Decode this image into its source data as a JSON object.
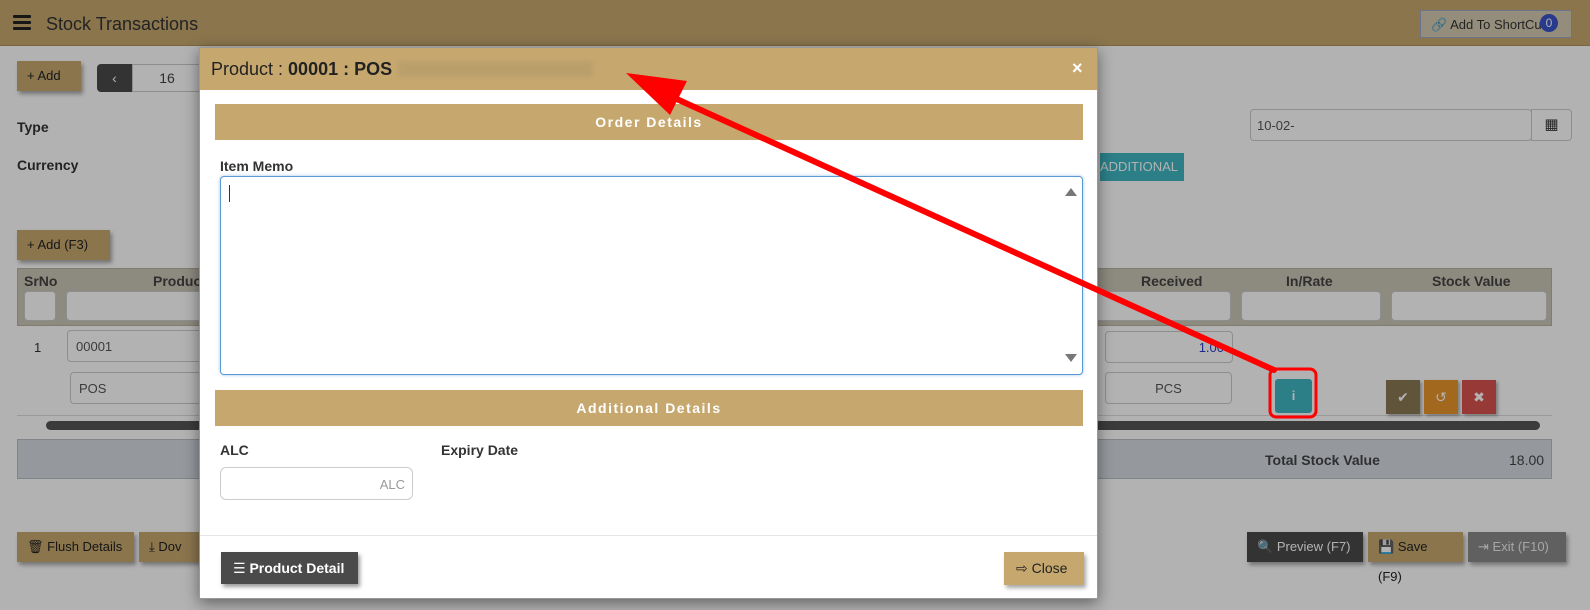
{
  "app": {
    "title": "Stock Transactions",
    "shortcut_label": "Add To ShortCut",
    "shortcut_count": "0",
    "add_label": "+ Add",
    "record_number": "16",
    "type_label": "Type",
    "currency_label": "Currency",
    "date_value": "10-02-",
    "additional_label": "ADDITIONAL",
    "add_row_label": "+ Add (F3)"
  },
  "grid": {
    "headers": {
      "srno": "SrNo",
      "product": "Produc",
      "received": "Received",
      "in_rate": "In/Rate",
      "stock_value": "Stock Value"
    },
    "row": {
      "srno": "1",
      "product_code": "00001",
      "product_name": "POS",
      "received": "1.00",
      "unit": "PCS"
    },
    "total_label": "Total Stock Value",
    "total_value": "18.00"
  },
  "footer": {
    "flush_label": "Flush Details",
    "download_label": "Dov",
    "preview_label": "Preview (F7)",
    "save_label": "Save (F9)",
    "exit_label": "Exit (F10)"
  },
  "modal": {
    "title_prefix": "Product : ",
    "title_product": "00001 : POS",
    "close_x": "×",
    "order_section": "Order Details",
    "item_memo_label": "Item Memo",
    "additional_section": "Additional Details",
    "alc_label": "ALC",
    "alc_placeholder": "ALC",
    "expiry_label": "Expiry Date",
    "product_detail_label": "Product Detail",
    "close_label": "Close"
  },
  "colors": {
    "accent_gold": "#c6a86f",
    "info_teal": "#3fb6c2",
    "annotation_red": "#ff0000"
  }
}
